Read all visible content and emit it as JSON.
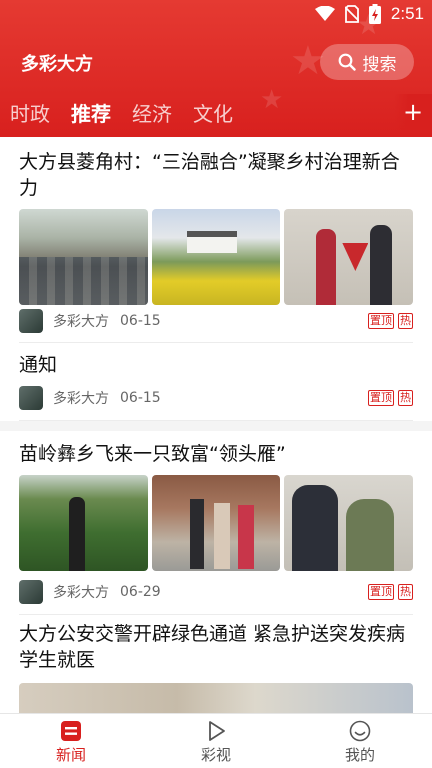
{
  "status_bar": {
    "time": "2:51",
    "icons": [
      "wifi-icon",
      "no-sim-icon",
      "battery-charging-icon"
    ]
  },
  "header": {
    "app_title": "多彩大方",
    "search_label": "搜索",
    "search_icon": "search-icon",
    "add_icon": "plus-icon"
  },
  "tabs": [
    {
      "label": "时政",
      "active": false
    },
    {
      "label": "推荐",
      "active": true
    },
    {
      "label": "经济",
      "active": false
    },
    {
      "label": "文化",
      "active": false
    }
  ],
  "articles": [
    {
      "title": "大方县菱角村：“三治融合”凝聚乡村治理新合力",
      "source": "多彩大方",
      "date": "06-15",
      "tags": [
        "置顶",
        "热"
      ]
    },
    {
      "title": "通知",
      "source": "多彩大方",
      "date": "06-15",
      "tags": [
        "置顶",
        "热"
      ]
    },
    {
      "title": "苗岭彝乡飞来一只致富“领头雁”",
      "source": "多彩大方",
      "date": "06-29",
      "tags": [
        "置顶",
        "热"
      ]
    },
    {
      "title": "大方公安交警开辟绿色通道 紧急护送突发疾病学生就医"
    }
  ],
  "bottom_nav": [
    {
      "label": "新闻",
      "icon": "news-icon",
      "active": true
    },
    {
      "label": "彩视",
      "icon": "play-icon",
      "active": false
    },
    {
      "label": "我的",
      "icon": "smile-icon",
      "active": false
    }
  ],
  "colors": {
    "brand_red": "#d8201e",
    "text": "#111111",
    "meta": "#666666"
  }
}
